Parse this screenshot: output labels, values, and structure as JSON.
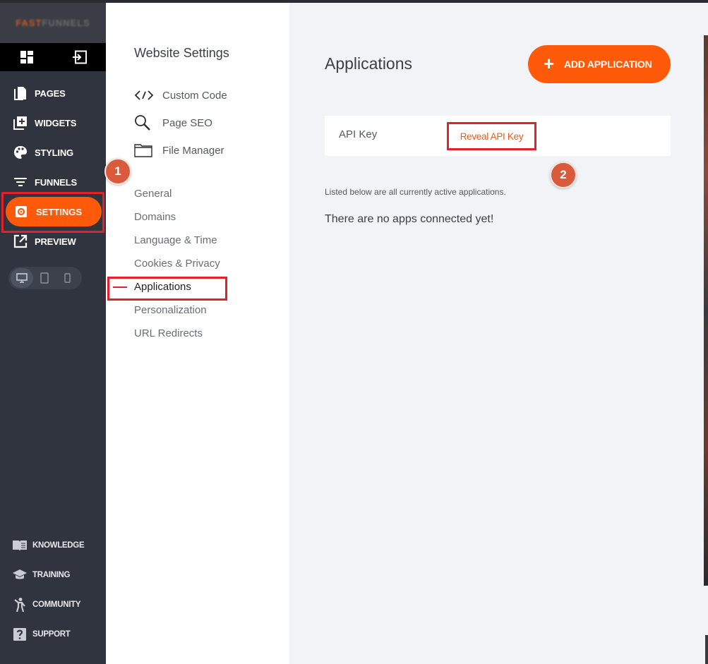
{
  "sidebar": {
    "logo": {
      "text_dim": "FAST",
      "text_accent": "FUNNELS"
    },
    "nav": [
      {
        "label": "PAGES",
        "icon": "pages-icon"
      },
      {
        "label": "WIDGETS",
        "icon": "widgets-icon"
      },
      {
        "label": "STYLING",
        "icon": "palette-icon"
      },
      {
        "label": "FUNNELS",
        "icon": "funnel-icon"
      }
    ],
    "settings": {
      "label": "SETTINGS",
      "icon": "gear-icon"
    },
    "preview": {
      "label": "PREVIEW",
      "icon": "external-link-icon"
    },
    "bottom": [
      {
        "label": "KNOWLEDGE",
        "icon": "book-icon"
      },
      {
        "label": "TRAINING",
        "icon": "graduation-cap-icon"
      },
      {
        "label": "COMMUNITY",
        "icon": "person-icon"
      },
      {
        "label": "SUPPORT",
        "icon": "question-icon"
      }
    ]
  },
  "settings_panel": {
    "title": "Website Settings",
    "tools": [
      {
        "label": "Custom Code",
        "icon": "code-icon"
      },
      {
        "label": "Page SEO",
        "icon": "search-icon"
      },
      {
        "label": "File Manager",
        "icon": "folder-icon"
      }
    ],
    "sections": [
      "General",
      "Domains",
      "Language & Time",
      "Cookies & Privacy",
      "Applications",
      "Personalization",
      "URL Redirects"
    ],
    "active_section": "Applications"
  },
  "annotations": {
    "step1": "1",
    "step2": "2"
  },
  "main": {
    "title": "Applications",
    "add_button": {
      "plus": "+",
      "label": "ADD APPLICATION"
    },
    "api_key": {
      "label": "API Key",
      "link": "Reveal API Key"
    },
    "listed_text": "Listed below are all currently active applications.",
    "empty_text": "There are no apps connected yet!"
  },
  "colors": {
    "accent": "#ff5a0a",
    "highlight_border": "#e4202b",
    "sidebar_bg": "#30343f",
    "badge": "#d95a3c"
  }
}
